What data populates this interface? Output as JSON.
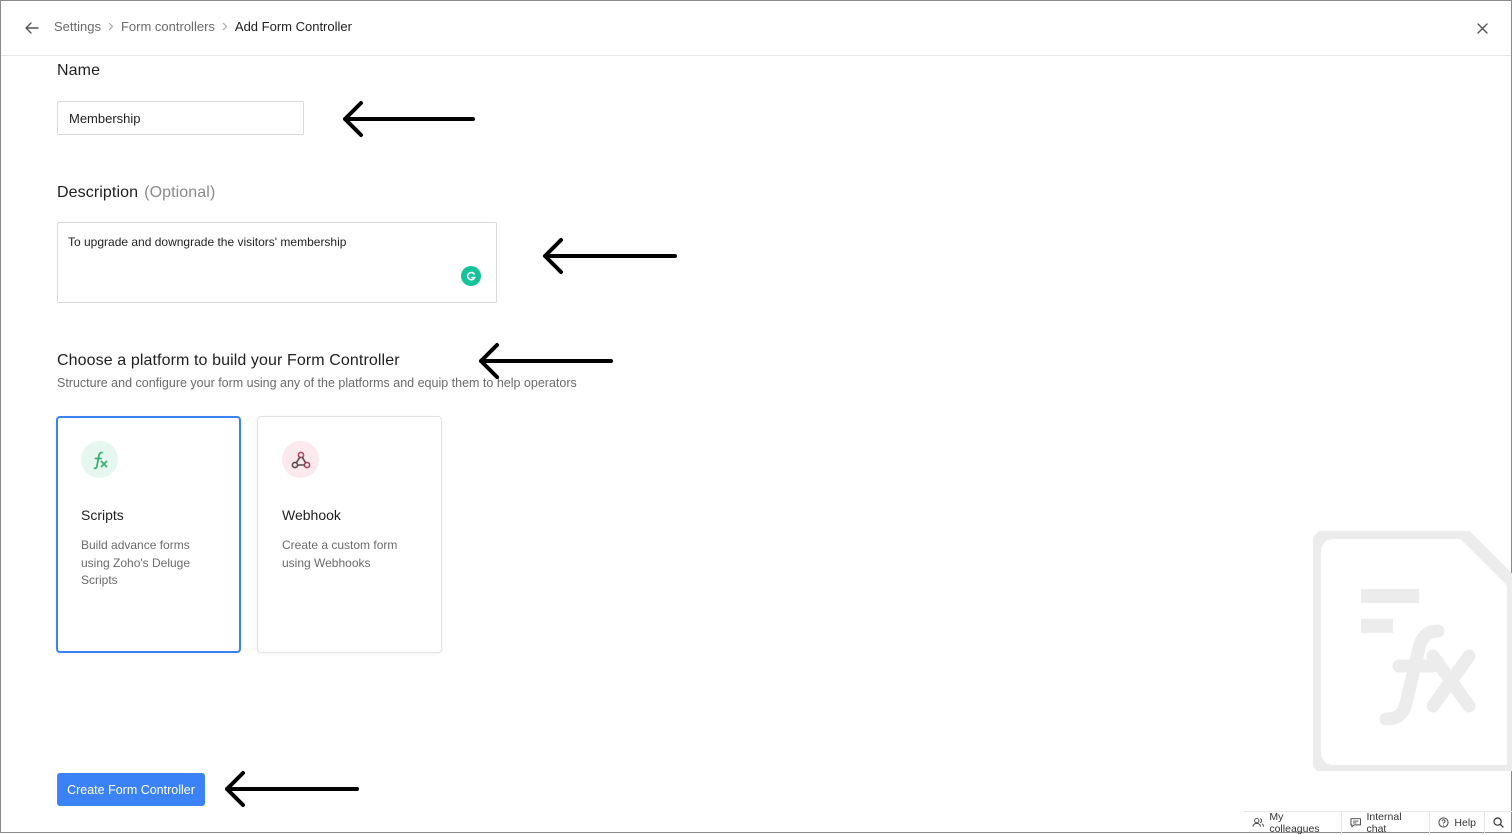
{
  "breadcrumb": {
    "items": [
      "Settings",
      "Form controllers",
      "Add Form Controller"
    ]
  },
  "name_section": {
    "label": "Name",
    "value": "Membership"
  },
  "description_section": {
    "label": "Description",
    "optional": "(Optional)",
    "value": "To upgrade and downgrade the visitors' membership"
  },
  "platform_section": {
    "title": "Choose a platform to build your Form Controller",
    "subtitle": "Structure and configure your form using any of the platforms and equip them to help operators",
    "options": [
      {
        "title": "Scripts",
        "description": "Build advance forms using Zoho's Deluge Scripts",
        "icon": "fx-icon",
        "selected": true
      },
      {
        "title": "Webhook",
        "description": "Create a custom form using Webhooks",
        "icon": "webhook-icon",
        "selected": false
      }
    ]
  },
  "actions": {
    "create_label": "Create Form Controller"
  },
  "footer": {
    "colleagues": "My colleagues",
    "chat": "Internal chat",
    "help": "Help"
  },
  "colors": {
    "accent": "#3b82f6",
    "scripts_icon_bg": "#e6f7ef",
    "webhook_icon_bg": "#fbe9ee"
  }
}
